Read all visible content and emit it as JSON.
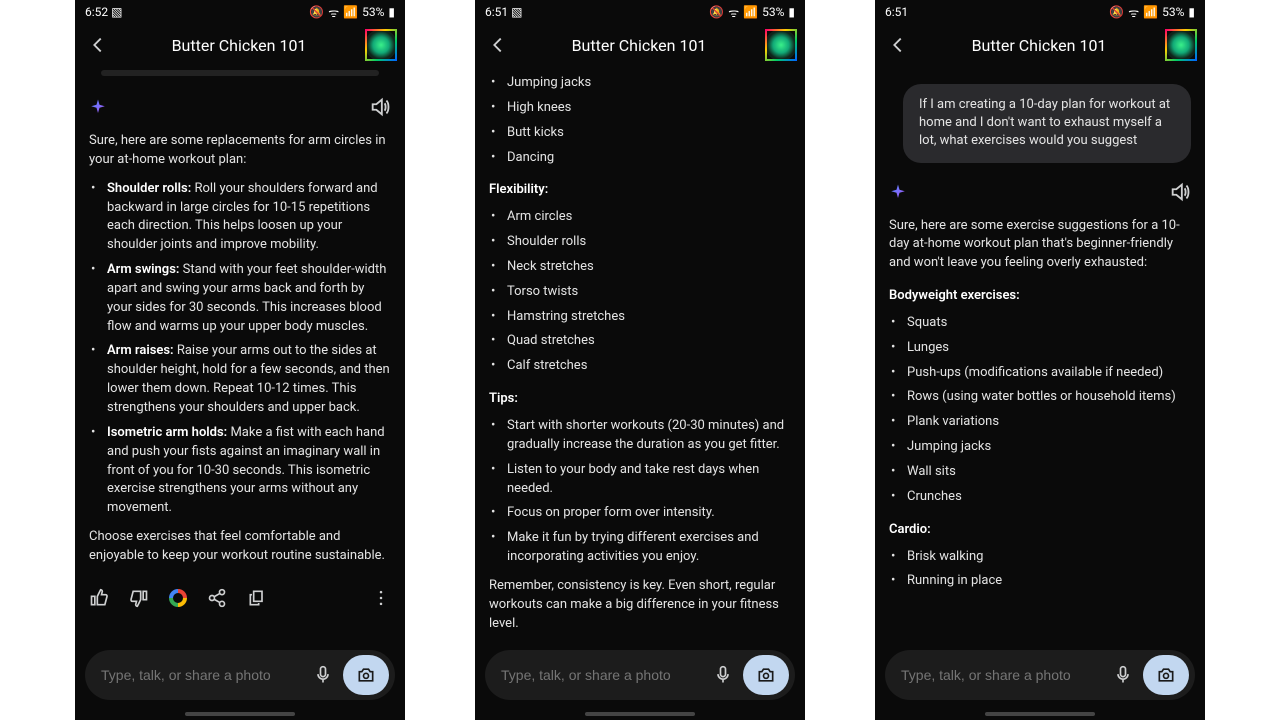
{
  "status": {
    "time1": "6:52",
    "time2": "6:51",
    "time3": "6:51",
    "battery": "53%",
    "picture_icon": "image-icon"
  },
  "header": {
    "title": "Butter Chicken 101"
  },
  "input": {
    "placeholder": "Type, talk, or share a photo"
  },
  "screen1": {
    "intro": "Sure, here are some replacements for arm circles in your at-home workout plan:",
    "bullets": [
      {
        "label": "Shoulder rolls:",
        "text": " Roll your shoulders forward and backward in large circles for 10-15 repetitions each direction. This helps loosen up your shoulder joints and improve mobility."
      },
      {
        "label": "Arm swings:",
        "text": " Stand with your feet shoulder-width apart and swing your arms back and forth by your sides for 30 seconds. This increases blood flow and warms up your upper body muscles."
      },
      {
        "label": "Arm raises:",
        "text": " Raise your arms out to the sides at shoulder height, hold for a few seconds, and then lower them down. Repeat 10-12 times. This strengthens your shoulders and upper back."
      },
      {
        "label": "Isometric arm holds:",
        "text": " Make a fist with each hand and push your fists against an imaginary wall in front of you for 10-30 seconds. This isometric exercise strengthens your arms without any movement."
      }
    ],
    "outro": "Choose exercises that feel comfortable and enjoyable to keep your workout routine sustainable."
  },
  "screen2": {
    "cardio_extra": [
      "Jumping jacks",
      "High knees",
      "Butt kicks",
      "Dancing"
    ],
    "flex_head": "Flexibility:",
    "flex": [
      "Arm circles",
      "Shoulder rolls",
      "Neck stretches",
      "Torso twists",
      "Hamstring stretches",
      "Quad stretches",
      "Calf stretches"
    ],
    "tips_head": "Tips:",
    "tips": [
      "Start with shorter workouts (20-30 minutes) and gradually increase the duration as you get fitter.",
      "Listen to your body and take rest days when needed.",
      "Focus on proper form over intensity.",
      "Make it fun by trying different exercises and incorporating activities you enjoy."
    ],
    "outro": "Remember, consistency is key. Even short, regular workouts can make a big difference in your fitness level."
  },
  "screen3": {
    "user_msg": "If I am creating a 10-day plan for workout at home and I don't want to exhaust myself a lot, what exercises would you suggest",
    "intro": "Sure, here are some exercise suggestions for a 10-day at-home workout plan that's beginner-friendly and won't leave you feeling overly exhausted:",
    "bw_head": "Bodyweight exercises:",
    "bw": [
      "Squats",
      "Lunges",
      "Push-ups (modifications available if needed)",
      "Rows (using water bottles or household items)",
      "Plank variations",
      "Jumping jacks",
      "Wall sits",
      "Crunches"
    ],
    "cardio_head": "Cardio:",
    "cardio": [
      "Brisk walking",
      "Running in place"
    ]
  }
}
